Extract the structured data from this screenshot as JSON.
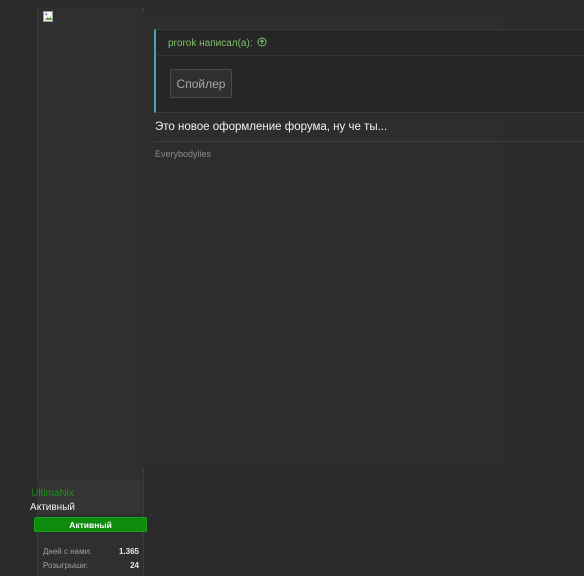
{
  "post": {
    "quote": {
      "author_line": "prorok написал(а):",
      "spoiler_label": "Спойлер"
    },
    "text": "Это новое оформление форума, ну че ты...",
    "signature": "Everybodylies"
  },
  "user": {
    "username": "UltimaNix",
    "title": "Активный",
    "banner": "Активный",
    "stats": [
      {
        "label": "Дней с нами:",
        "value": "1.365"
      },
      {
        "label": "Розыгрыши:",
        "value": "24"
      }
    ]
  },
  "colors": {
    "accent_green": "#7fc06a",
    "banner_green": "#0e8a0e",
    "quote_border": "#4aa3b5"
  }
}
